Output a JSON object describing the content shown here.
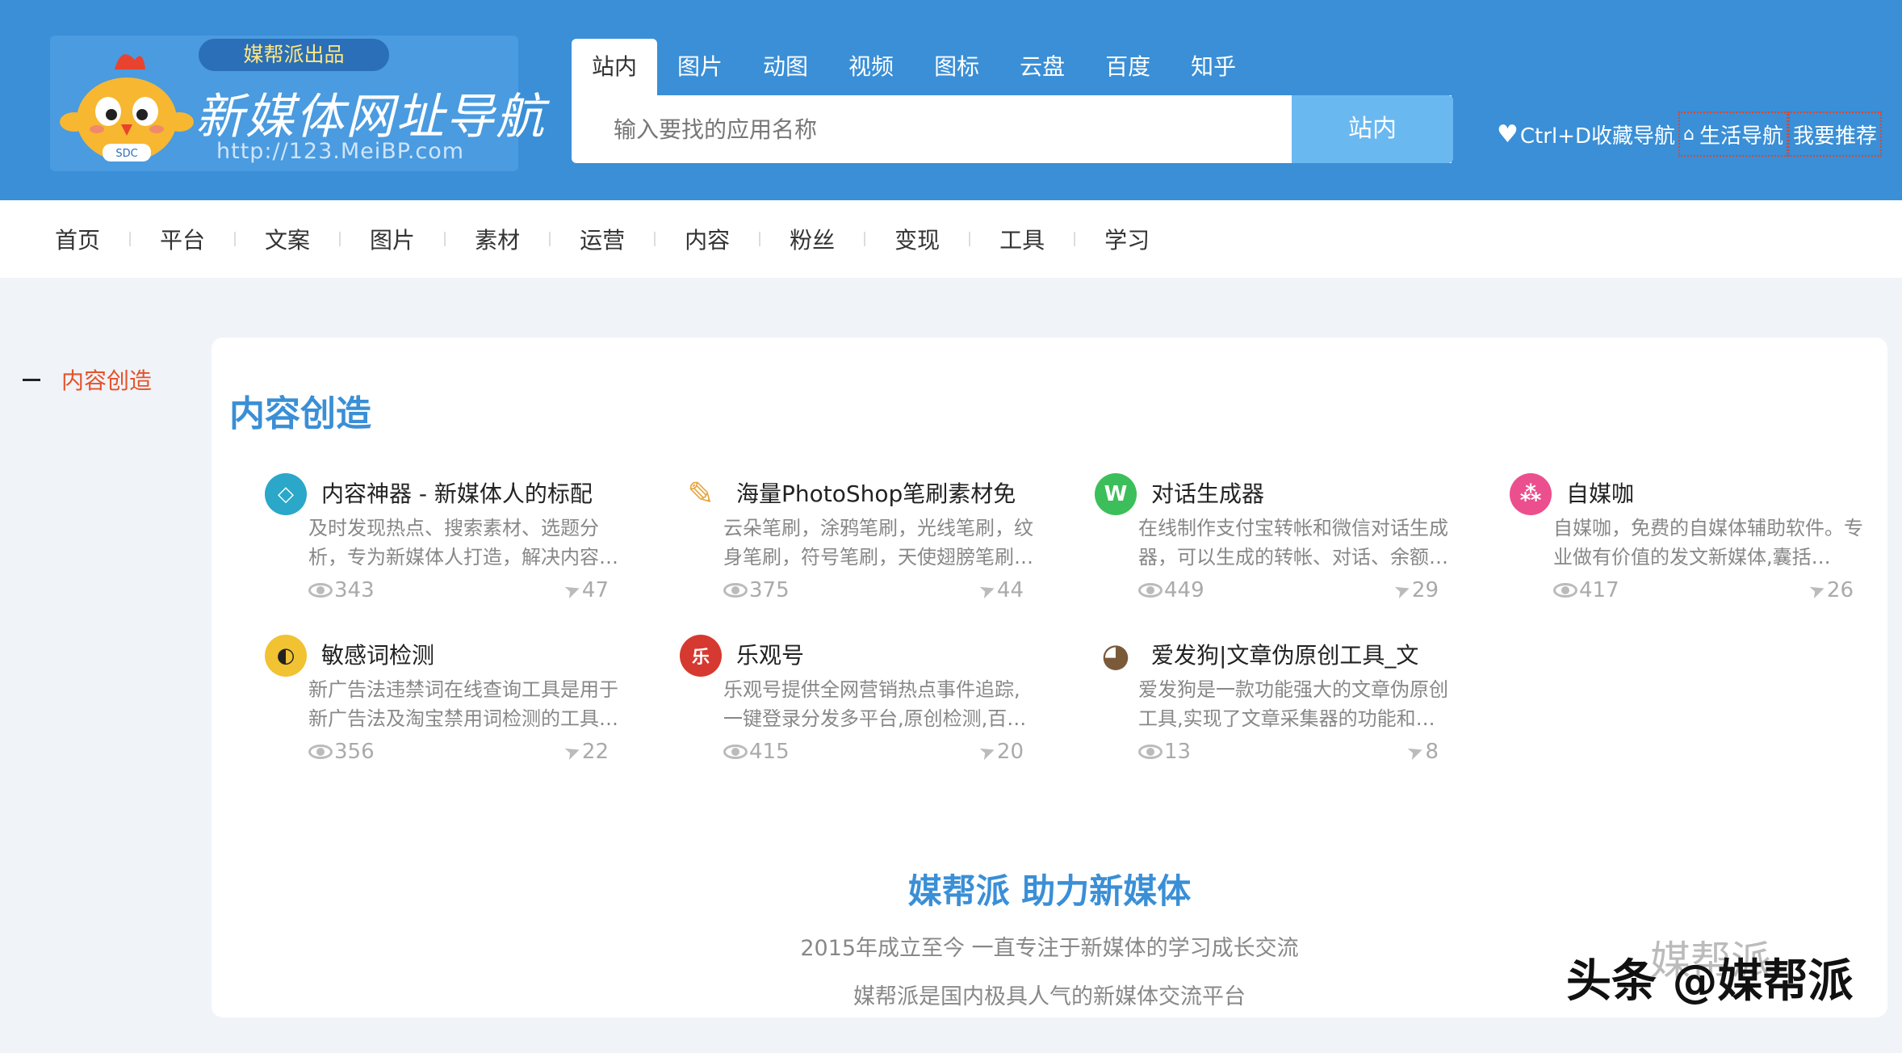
{
  "header": {
    "logo": {
      "tag": "媒帮派出品",
      "title": "新媒体网址导航",
      "url": "http://123.MeiBP.com",
      "badge": "SDC"
    },
    "tabs": [
      "站内",
      "图片",
      "动图",
      "视频",
      "图标",
      "云盘",
      "百度",
      "知乎"
    ],
    "search": {
      "placeholder": "输入要找的应用名称",
      "button": "站内"
    },
    "links": {
      "bookmark": "Ctrl+D收藏导航",
      "life": "生活导航",
      "recommend": "我要推荐"
    }
  },
  "nav": [
    "首页",
    "平台",
    "文案",
    "图片",
    "素材",
    "运营",
    "内容",
    "粉丝",
    "变现",
    "工具",
    "学习"
  ],
  "sidebar": {
    "active": "内容创造"
  },
  "section": {
    "title": "内容创造",
    "cards": [
      {
        "title": "内容神器 - 新媒体人的标配",
        "desc": "及时发现热点、搜索素材、选题分析，专为新媒体人打造，解决内容…",
        "views": "343",
        "shares": "47",
        "icon": "diamond-icon",
        "color": "#2aa7c9",
        "glyph": "◇"
      },
      {
        "title": "海量PhotoShop笔刷素材免",
        "desc": "云朵笔刷，涂鸦笔刷，光线笔刷，纹身笔刷，符号笔刷，天使翅膀笔刷…",
        "views": "375",
        "shares": "44",
        "icon": "brush-icon",
        "color": "#e8a33a",
        "glyph": "✎"
      },
      {
        "title": "对话生成器",
        "desc": "在线制作支付宝转帐和微信对话生成器，可以生成的转帐、对话、余额…",
        "views": "449",
        "shares": "29",
        "icon": "w-logo-icon",
        "color": "#3cbf5a",
        "glyph": "W"
      },
      {
        "title": "自媒咖",
        "desc": "自媒咖，免费的自媒体辅助软件。专业做有价值的发文新媒体,囊括…",
        "views": "417",
        "shares": "26",
        "icon": "network-icon",
        "color": "#ec4f8e",
        "glyph": "⁂"
      },
      {
        "title": "敏感词检测",
        "desc": "新广告法违禁词在线查询工具是用于新广告法及淘宝禁用词检测的工具…",
        "views": "356",
        "shares": "22",
        "icon": "bird-icon",
        "color": "#f1c232",
        "glyph": "◐"
      },
      {
        "title": "乐观号",
        "desc": "乐观号提供全网营销热点事件追踪,一键登录分发多平台,原创检测,百…",
        "views": "415",
        "shares": "20",
        "icon": "leguan-logo-icon",
        "color": "#d6392f",
        "glyph": "乐"
      },
      {
        "title": "爱发狗|文章伪原创工具_文",
        "desc": "爱发狗是一款功能强大的文章伪原创工具,实现了文章采集器的功能和…",
        "views": "13",
        "shares": "8",
        "icon": "dog-icon",
        "color": "#7b5a3a",
        "glyph": "◕"
      }
    ]
  },
  "footer": {
    "title": "媒帮派 助力新媒体",
    "line1": "2015年成立至今 一直专注于新媒体的学习成长交流",
    "line2": "媒帮派是国内极具人气的新媒体交流平台"
  },
  "watermark": {
    "front": "头条 @媒帮派",
    "back": "媒帮派"
  }
}
